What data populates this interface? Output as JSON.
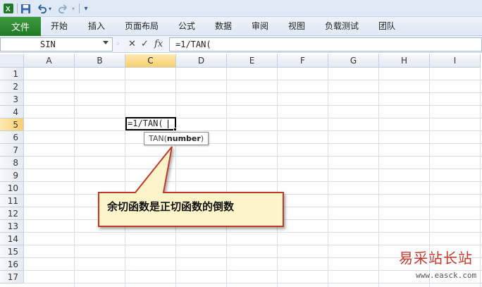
{
  "quick_access": {
    "save_icon": "save-icon",
    "undo_icon": "undo-icon",
    "redo_icon": "redo-icon",
    "customize_icon": "customize-icon"
  },
  "ribbon": {
    "file_label": "文件",
    "tabs": [
      "开始",
      "插入",
      "页面布局",
      "公式",
      "数据",
      "审阅",
      "视图",
      "负载测试",
      "团队"
    ],
    "file_color": "#2a8a2e"
  },
  "formula_bar": {
    "name_box": "SIN",
    "cancel_icon": "✕",
    "enter_icon": "✓",
    "fx_label": "fx",
    "formula": "=1/TAN("
  },
  "grid": {
    "columns": [
      "A",
      "B",
      "C",
      "D",
      "E",
      "F",
      "G",
      "H",
      "I"
    ],
    "rows": [
      "1",
      "2",
      "3",
      "4",
      "5",
      "6",
      "7",
      "8",
      "9",
      "10",
      "11",
      "12",
      "13",
      "14",
      "15",
      "16",
      "17"
    ],
    "active_column": "C",
    "active_row": "5",
    "active_cell_text": "=1/TAN(",
    "tooltip_func": "TAN(",
    "tooltip_arg": "number",
    "tooltip_close": ")"
  },
  "callout": {
    "text": "余切函数是正切函数的倒数",
    "fill_color": "#fdf5c9",
    "border_color": "#c0392b"
  },
  "watermark": {
    "title": "易采站长站",
    "url": "www.easck.com"
  }
}
